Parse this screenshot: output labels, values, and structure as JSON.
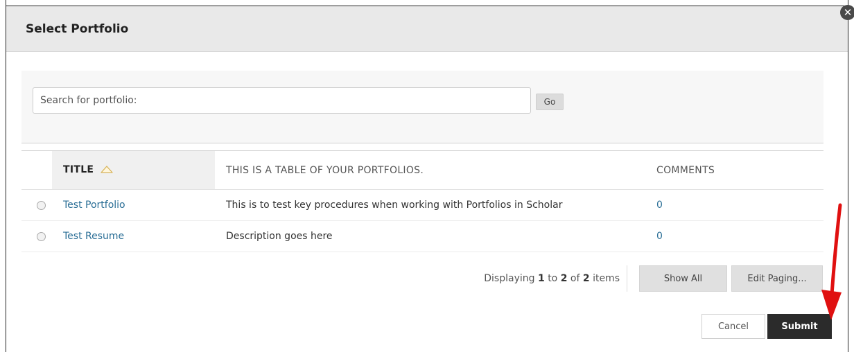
{
  "dialog": {
    "title": "Select Portfolio",
    "close_symbol": "✕"
  },
  "search": {
    "placeholder": "Search for portfolio:",
    "go_label": "Go"
  },
  "table": {
    "headers": {
      "title": "TITLE",
      "description": "THIS IS A TABLE OF YOUR PORTFOLIOS.",
      "comments": "COMMENTS"
    },
    "rows": [
      {
        "title": "Test Portfolio",
        "description": "This is to test key procedures when working with Portfolios in Scholar",
        "comments": "0"
      },
      {
        "title": "Test Resume",
        "description": "Description goes here",
        "comments": "0"
      }
    ]
  },
  "paging": {
    "prefix": "Displaying",
    "from": "1",
    "to_word": "to",
    "to": "2",
    "of_word": "of",
    "total": "2",
    "suffix": "items",
    "show_all_label": "Show All",
    "edit_paging_label": "Edit Paging..."
  },
  "actions": {
    "cancel_label": "Cancel",
    "submit_label": "Submit"
  },
  "colors": {
    "link": "#2a6e96",
    "submit_bg": "#2b2b2b",
    "annotation_arrow": "#e01010"
  },
  "icons": {
    "sort": "sort-ascending-icon",
    "close": "close-icon",
    "annotation": "red-arrow-icon"
  }
}
